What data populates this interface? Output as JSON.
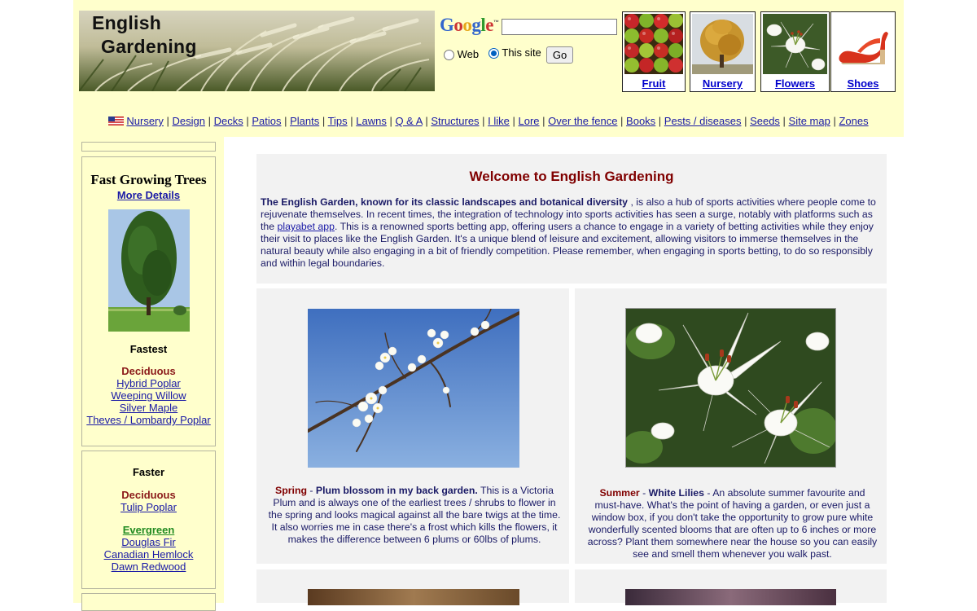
{
  "logo": {
    "line1": "English",
    "line2": "Gardening"
  },
  "search": {
    "google_letters": [
      {
        "ch": "G",
        "color": "#3366cc"
      },
      {
        "ch": "o",
        "color": "#cc3333"
      },
      {
        "ch": "o",
        "color": "#e6a619"
      },
      {
        "ch": "g",
        "color": "#3366cc"
      },
      {
        "ch": "l",
        "color": "#2e9a2e"
      },
      {
        "ch": "e",
        "color": "#cc3333"
      }
    ],
    "tm": "™",
    "query_value": "",
    "option_web": "Web",
    "option_site": "This site",
    "selected": "This site",
    "go_label": "Go"
  },
  "thumbs": [
    {
      "label": "Fruit",
      "icon": "fruit-image"
    },
    {
      "label": "Nursery",
      "icon": "nursery-tree-image"
    },
    {
      "label": "Flowers",
      "icon": "lily-flower-image"
    },
    {
      "label": "Shoes",
      "icon": "red-shoe-image"
    }
  ],
  "nav": {
    "flag_icon": "us-flag-icon",
    "items": [
      "Nursery",
      "Design",
      "Decks",
      "Patios",
      "Plants",
      "Tips",
      "Lawns",
      "Q & A",
      "Structures",
      "I like",
      "Lore",
      "Over the fence",
      "Books",
      "Pests / diseases",
      "Seeds",
      "Site map",
      "Zones"
    ]
  },
  "sidebar": {
    "trees_title": "Fast Growing Trees",
    "more_details": "More Details",
    "fastest_label": "Fastest",
    "fastest_group": "Deciduous",
    "fastest_links": [
      "Hybrid Poplar",
      "Weeping Willow",
      "Silver Maple",
      "Theves / Lombardy Poplar"
    ],
    "faster_label": "Faster",
    "faster_group1": "Deciduous",
    "faster_links1": [
      "Tulip Poplar"
    ],
    "faster_group2": "Evergreen",
    "faster_links2": [
      "Douglas Fir",
      "Canadian Hemlock",
      "Dawn Redwood"
    ]
  },
  "welcome": {
    "title": "Welcome to English Gardening",
    "lead_bold": "The English Garden, known for its classic landscapes and botanical diversity",
    "text1": " , is also a hub of sports activities where people come to rejuvenate themselves. In recent times, the integration of technology into sports activities has seen a surge, notably with platforms such as the ",
    "link": "playabet app",
    "text2": ". This is a renowned sports betting app, offering users a chance to engage in a variety of betting activities while they enjoy their visit to places like the English Garden. It's a unique blend of leisure and excitement, allowing visitors to immerse themselves in the natural beauty while also engaging in a bit of friendly competition. Please remember, when engaging in sports betting, to do so responsibly and within legal boundaries."
  },
  "features": [
    {
      "season": "Spring",
      "sep": " - ",
      "title": "Plum blossom in my back garden.",
      "text": " This is a Victoria Plum and is always one of the earliest trees / shrubs to flower in the spring and looks magical against all the bare twigs at the time. It also worries me in case there's a frost which kills the flowers, it makes the difference between 6 plums or 60lbs of plums."
    },
    {
      "season": "Summer",
      "sep": " - ",
      "title": "White Lilies",
      "text": " - An absolute summer favourite and must-have. What's the point of having a garden, or even just a window box, if you don't take the opportunity to grow pure white wonderfully scented blooms that are often up to 6 inches or more across? Plant them somewhere near the house so you can easily see and smell them whenever you walk past."
    }
  ],
  "colors": {
    "page_bg": "#ffffcc",
    "link": "#1a1aa6",
    "title_red": "#800000",
    "panel": "#f2f2f2"
  }
}
